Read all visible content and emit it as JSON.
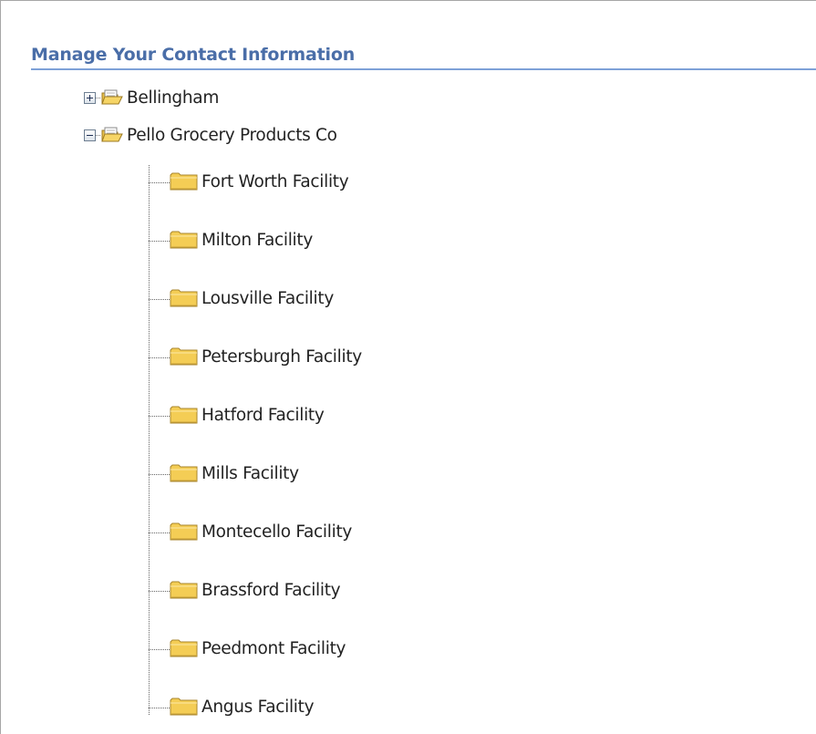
{
  "section": {
    "title": "Manage Your Contact Information"
  },
  "tree": {
    "nodes": [
      {
        "label": "Bellingham",
        "expander": "+",
        "state": "collapsed",
        "icon": "open-folder-icon"
      },
      {
        "label": "Pello Grocery Products Co",
        "expander": "−",
        "state": "expanded",
        "icon": "open-folder-icon"
      }
    ],
    "children": [
      {
        "label": "Fort Worth Facility",
        "icon": "folder-icon"
      },
      {
        "label": "Milton Facility",
        "icon": "folder-icon"
      },
      {
        "label": "Lousville Facility",
        "icon": "folder-icon"
      },
      {
        "label": "Petersburgh Facility",
        "icon": "folder-icon"
      },
      {
        "label": "Hatford Facility",
        "icon": "folder-icon"
      },
      {
        "label": "Mills Facility",
        "icon": "folder-icon"
      },
      {
        "label": "Montecello Facility",
        "icon": "folder-icon"
      },
      {
        "label": "Brassford Facility",
        "icon": "folder-icon"
      },
      {
        "label": "Peedmont Facility",
        "icon": "folder-icon"
      },
      {
        "label": "Angus Facility",
        "icon": "folder-icon"
      }
    ]
  },
  "colors": {
    "header_text": "#4a6ea8",
    "header_rule": "#7ea1d8",
    "folder_fill": "#f4cd55",
    "folder_outline": "#a8862c"
  }
}
